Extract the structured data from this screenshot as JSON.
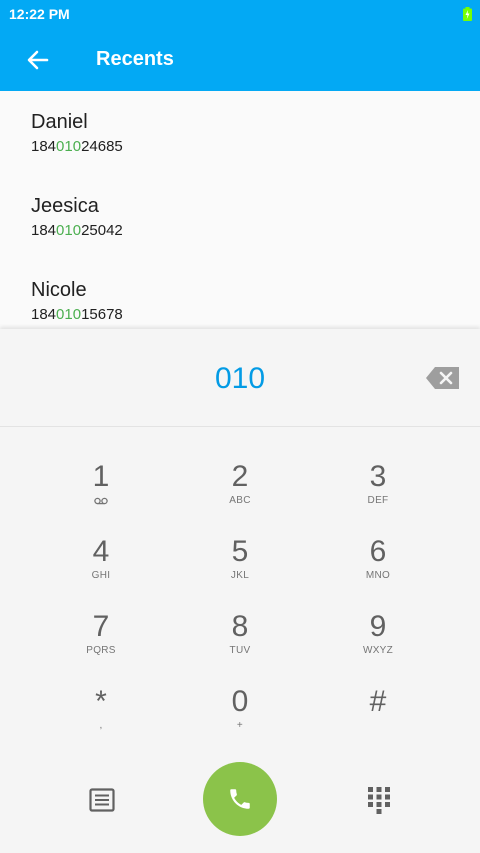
{
  "status_bar": {
    "time": "12:22 PM"
  },
  "app_bar": {
    "title": "Recents"
  },
  "recents": [
    {
      "name": "Daniel",
      "number_prefix": "184",
      "number_match": "010",
      "number_suffix": "24685"
    },
    {
      "name": "Jeesica",
      "number_prefix": "184",
      "number_match": "010",
      "number_suffix": "25042"
    },
    {
      "name": "Nicole",
      "number_prefix": "184",
      "number_match": "010",
      "number_suffix": "15678"
    }
  ],
  "dialer": {
    "digits": "010",
    "keys": [
      {
        "num": "1",
        "sub": ""
      },
      {
        "num": "2",
        "sub": "ABC"
      },
      {
        "num": "3",
        "sub": "DEF"
      },
      {
        "num": "4",
        "sub": "GHI"
      },
      {
        "num": "5",
        "sub": "JKL"
      },
      {
        "num": "6",
        "sub": "MNO"
      },
      {
        "num": "7",
        "sub": "PQRS"
      },
      {
        "num": "8",
        "sub": "TUV"
      },
      {
        "num": "9",
        "sub": "WXYZ"
      },
      {
        "num": "*",
        "sub": ","
      },
      {
        "num": "0",
        "sub": "+"
      },
      {
        "num": "#",
        "sub": ""
      }
    ]
  },
  "colors": {
    "app_bar": "#03a9f4",
    "digits": "#039be5",
    "match_highlight": "#4caf50",
    "call_button": "#8bc34a"
  },
  "icons": {
    "back": "arrow-left-icon",
    "battery": "battery-charging-icon",
    "backspace": "backspace-icon",
    "voicemail": "voicemail-icon",
    "menu": "list-icon",
    "call": "phone-icon",
    "dialpad": "dialpad-icon"
  }
}
